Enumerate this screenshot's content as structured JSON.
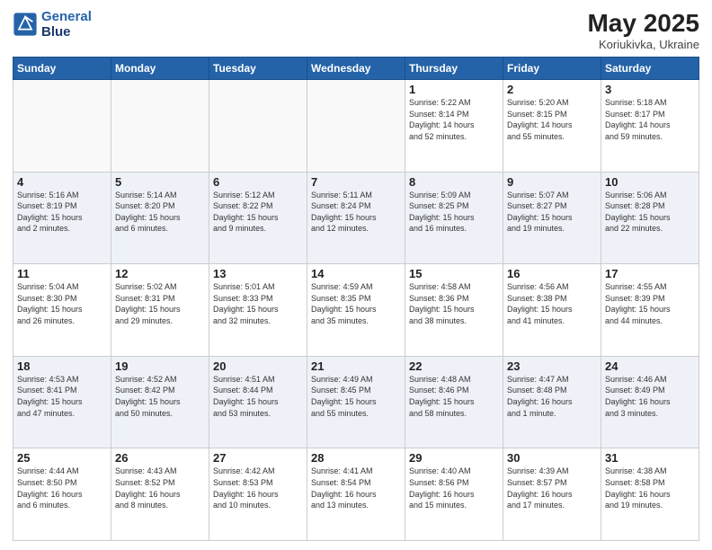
{
  "header": {
    "logo_line1": "General",
    "logo_line2": "Blue",
    "month_year": "May 2025",
    "location": "Koriukivka, Ukraine"
  },
  "days_of_week": [
    "Sunday",
    "Monday",
    "Tuesday",
    "Wednesday",
    "Thursday",
    "Friday",
    "Saturday"
  ],
  "weeks": [
    [
      {
        "day": "",
        "info": ""
      },
      {
        "day": "",
        "info": ""
      },
      {
        "day": "",
        "info": ""
      },
      {
        "day": "",
        "info": ""
      },
      {
        "day": "1",
        "info": "Sunrise: 5:22 AM\nSunset: 8:14 PM\nDaylight: 14 hours\nand 52 minutes."
      },
      {
        "day": "2",
        "info": "Sunrise: 5:20 AM\nSunset: 8:15 PM\nDaylight: 14 hours\nand 55 minutes."
      },
      {
        "day": "3",
        "info": "Sunrise: 5:18 AM\nSunset: 8:17 PM\nDaylight: 14 hours\nand 59 minutes."
      }
    ],
    [
      {
        "day": "4",
        "info": "Sunrise: 5:16 AM\nSunset: 8:19 PM\nDaylight: 15 hours\nand 2 minutes."
      },
      {
        "day": "5",
        "info": "Sunrise: 5:14 AM\nSunset: 8:20 PM\nDaylight: 15 hours\nand 6 minutes."
      },
      {
        "day": "6",
        "info": "Sunrise: 5:12 AM\nSunset: 8:22 PM\nDaylight: 15 hours\nand 9 minutes."
      },
      {
        "day": "7",
        "info": "Sunrise: 5:11 AM\nSunset: 8:24 PM\nDaylight: 15 hours\nand 12 minutes."
      },
      {
        "day": "8",
        "info": "Sunrise: 5:09 AM\nSunset: 8:25 PM\nDaylight: 15 hours\nand 16 minutes."
      },
      {
        "day": "9",
        "info": "Sunrise: 5:07 AM\nSunset: 8:27 PM\nDaylight: 15 hours\nand 19 minutes."
      },
      {
        "day": "10",
        "info": "Sunrise: 5:06 AM\nSunset: 8:28 PM\nDaylight: 15 hours\nand 22 minutes."
      }
    ],
    [
      {
        "day": "11",
        "info": "Sunrise: 5:04 AM\nSunset: 8:30 PM\nDaylight: 15 hours\nand 26 minutes."
      },
      {
        "day": "12",
        "info": "Sunrise: 5:02 AM\nSunset: 8:31 PM\nDaylight: 15 hours\nand 29 minutes."
      },
      {
        "day": "13",
        "info": "Sunrise: 5:01 AM\nSunset: 8:33 PM\nDaylight: 15 hours\nand 32 minutes."
      },
      {
        "day": "14",
        "info": "Sunrise: 4:59 AM\nSunset: 8:35 PM\nDaylight: 15 hours\nand 35 minutes."
      },
      {
        "day": "15",
        "info": "Sunrise: 4:58 AM\nSunset: 8:36 PM\nDaylight: 15 hours\nand 38 minutes."
      },
      {
        "day": "16",
        "info": "Sunrise: 4:56 AM\nSunset: 8:38 PM\nDaylight: 15 hours\nand 41 minutes."
      },
      {
        "day": "17",
        "info": "Sunrise: 4:55 AM\nSunset: 8:39 PM\nDaylight: 15 hours\nand 44 minutes."
      }
    ],
    [
      {
        "day": "18",
        "info": "Sunrise: 4:53 AM\nSunset: 8:41 PM\nDaylight: 15 hours\nand 47 minutes."
      },
      {
        "day": "19",
        "info": "Sunrise: 4:52 AM\nSunset: 8:42 PM\nDaylight: 15 hours\nand 50 minutes."
      },
      {
        "day": "20",
        "info": "Sunrise: 4:51 AM\nSunset: 8:44 PM\nDaylight: 15 hours\nand 53 minutes."
      },
      {
        "day": "21",
        "info": "Sunrise: 4:49 AM\nSunset: 8:45 PM\nDaylight: 15 hours\nand 55 minutes."
      },
      {
        "day": "22",
        "info": "Sunrise: 4:48 AM\nSunset: 8:46 PM\nDaylight: 15 hours\nand 58 minutes."
      },
      {
        "day": "23",
        "info": "Sunrise: 4:47 AM\nSunset: 8:48 PM\nDaylight: 16 hours\nand 1 minute."
      },
      {
        "day": "24",
        "info": "Sunrise: 4:46 AM\nSunset: 8:49 PM\nDaylight: 16 hours\nand 3 minutes."
      }
    ],
    [
      {
        "day": "25",
        "info": "Sunrise: 4:44 AM\nSunset: 8:50 PM\nDaylight: 16 hours\nand 6 minutes."
      },
      {
        "day": "26",
        "info": "Sunrise: 4:43 AM\nSunset: 8:52 PM\nDaylight: 16 hours\nand 8 minutes."
      },
      {
        "day": "27",
        "info": "Sunrise: 4:42 AM\nSunset: 8:53 PM\nDaylight: 16 hours\nand 10 minutes."
      },
      {
        "day": "28",
        "info": "Sunrise: 4:41 AM\nSunset: 8:54 PM\nDaylight: 16 hours\nand 13 minutes."
      },
      {
        "day": "29",
        "info": "Sunrise: 4:40 AM\nSunset: 8:56 PM\nDaylight: 16 hours\nand 15 minutes."
      },
      {
        "day": "30",
        "info": "Sunrise: 4:39 AM\nSunset: 8:57 PM\nDaylight: 16 hours\nand 17 minutes."
      },
      {
        "day": "31",
        "info": "Sunrise: 4:38 AM\nSunset: 8:58 PM\nDaylight: 16 hours\nand 19 minutes."
      }
    ]
  ]
}
